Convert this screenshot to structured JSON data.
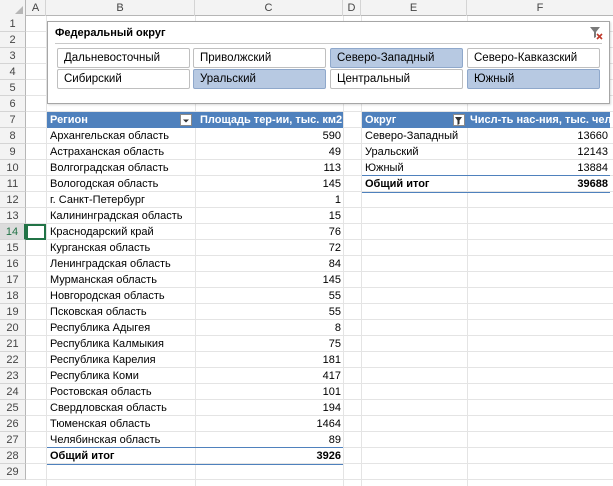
{
  "sheet": {
    "columns": [
      "A",
      "B",
      "C",
      "D",
      "E",
      "F"
    ],
    "rows": [
      "1",
      "2",
      "3",
      "4",
      "5",
      "6",
      "7",
      "8",
      "9",
      "10",
      "11",
      "12",
      "13",
      "14",
      "15",
      "16",
      "17",
      "18",
      "19",
      "20",
      "21",
      "22",
      "23",
      "24",
      "25",
      "26",
      "27",
      "28",
      "29"
    ],
    "active_row": "14"
  },
  "slicer": {
    "title": "Федеральный округ",
    "clear_icon": "clear-filter-icon",
    "items": [
      {
        "label": "Дальневосточный",
        "selected": false
      },
      {
        "label": "Приволжский",
        "selected": false
      },
      {
        "label": "Северо-Западный",
        "selected": true
      },
      {
        "label": "Северо-Кавказский",
        "selected": false
      },
      {
        "label": "Сибирский",
        "selected": false
      },
      {
        "label": "Уральский",
        "selected": true
      },
      {
        "label": "Центральный",
        "selected": false
      },
      {
        "label": "Южный",
        "selected": true
      }
    ],
    "selected_color": "#b7c9e2"
  },
  "pivot_regions": {
    "header_region": "Регион",
    "header_area": "Площадь тер-ии, тыс. км2",
    "rows": [
      {
        "region": "Архангельская область",
        "area": "590"
      },
      {
        "region": "Астраханская область",
        "area": "49"
      },
      {
        "region": "Волгоградская область",
        "area": "113"
      },
      {
        "region": "Вологодская область",
        "area": "145"
      },
      {
        "region": "г. Санкт-Петербург",
        "area": "1"
      },
      {
        "region": "Калининградская область",
        "area": "15"
      },
      {
        "region": "Краснодарский край",
        "area": "76"
      },
      {
        "region": "Курганская область",
        "area": "72"
      },
      {
        "region": "Ленинградская область",
        "area": "84"
      },
      {
        "region": "Мурманская область",
        "area": "145"
      },
      {
        "region": "Новгородская область",
        "area": "55"
      },
      {
        "region": "Псковская область",
        "area": "55"
      },
      {
        "region": "Республика Адыгея",
        "area": "8"
      },
      {
        "region": "Республика Калмыкия",
        "area": "75"
      },
      {
        "region": "Республика Карелия",
        "area": "181"
      },
      {
        "region": "Республика Коми",
        "area": "417"
      },
      {
        "region": "Ростовская область",
        "area": "101"
      },
      {
        "region": "Свердловская область",
        "area": "194"
      },
      {
        "region": "Тюменская область",
        "area": "1464"
      },
      {
        "region": "Челябинская область",
        "area": "89"
      }
    ],
    "total_label": "Общий итог",
    "total_value": "3926"
  },
  "pivot_districts": {
    "header_district": "Округ",
    "header_pop": "Числ-ть нас-ния, тыс. чел",
    "rows": [
      {
        "district": "Северо-Западный",
        "pop": "13660"
      },
      {
        "district": "Уральский",
        "pop": "12143"
      },
      {
        "district": "Южный",
        "pop": "13884"
      }
    ],
    "total_label": "Общий итог",
    "total_value": "39688"
  },
  "colors": {
    "header_blue": "#4f81bd",
    "excel_green": "#217346"
  }
}
